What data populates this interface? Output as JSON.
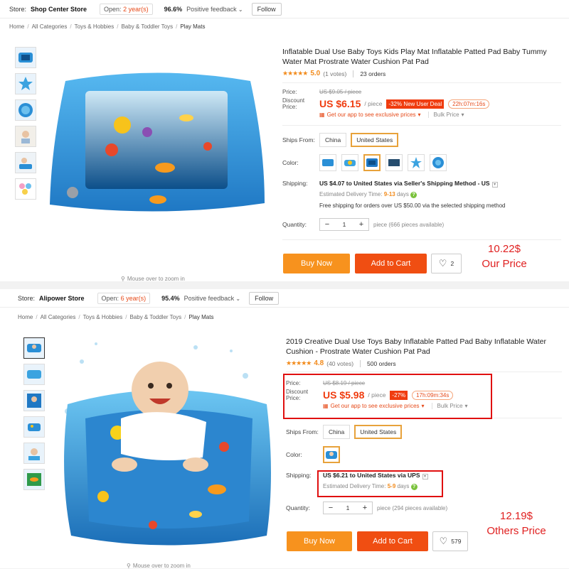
{
  "listings": [
    {
      "store": {
        "label": "Store:",
        "name": "Shop Center Store",
        "open_prefix": "Open:",
        "open_years": "2 year(s)",
        "feedback_pct": "96.6%",
        "feedback_label": "Positive feedback",
        "follow": "Follow"
      },
      "breadcrumb": {
        "items": [
          "Home",
          "All Categories",
          "Toys & Hobbies",
          "Baby & Toddler Toys",
          "Play Mats"
        ],
        "sep": "/"
      },
      "title": "Inflatable Dual Use Baby Toys Kids Play Mat Inflatable Patted Pad Baby Tummy Water Mat Prostrate Water Cushion Pat Pad",
      "rating": "5.0",
      "votes": "(1 votes)",
      "orders": "23 orders",
      "price_label": "Price:",
      "old_price": "US $9.05 / piece",
      "discount_label": "Discount Price:",
      "new_price": "US $6.15",
      "per_piece": "/ piece",
      "discount_badge": "-32% New User Deal",
      "timer": "22h:07m:16s",
      "app_promo": "Get our app to see exclusive prices",
      "bulk_price": "Bulk Price",
      "ships_from_label": "Ships From:",
      "ships_from": [
        "China",
        "United States"
      ],
      "color_label": "Color:",
      "shipping_label": "Shipping:",
      "shipping_main": "US $4.07 to United States via Seller's Shipping Method - US",
      "delivery_prefix": "Estimated Delivery Time:",
      "delivery_days": "9-13",
      "delivery_suffix": "days",
      "free_shipping": "Free shipping for orders over US $50.00 via the selected shipping method",
      "quantity_label": "Quantity:",
      "quantity": "1",
      "available": "piece (666 pieces available)",
      "buy_now": "Buy Now",
      "add_to_cart": "Add to Cart",
      "wish_count": "2",
      "zoom_hint": "Mouse over to zoom in",
      "annotation_value": "10.22$",
      "annotation_label": "Our Price"
    },
    {
      "store": {
        "label": "Store:",
        "name": "Alipower Store",
        "open_prefix": "Open:",
        "open_years": "6 year(s)",
        "feedback_pct": "95.4%",
        "feedback_label": "Positive feedback",
        "follow": "Follow"
      },
      "breadcrumb": {
        "items": [
          "Home",
          "All Categories",
          "Toys & Hobbies",
          "Baby & Toddler Toys",
          "Play Mats"
        ],
        "sep": "/"
      },
      "title": "2019 Creative Dual Use Toys Baby Inflatable Patted Pad Baby Inflatable Water Cushion - Prostrate Water Cushion Pat Pad",
      "rating": "4.8",
      "votes": "(40 votes)",
      "orders": "500 orders",
      "price_label": "Price:",
      "old_price": "US $8.19 / piece",
      "discount_label": "Discount Price:",
      "new_price": "US $5.98",
      "per_piece": "/ piece",
      "discount_badge": "-27%",
      "timer": "17h:09m:34s",
      "app_promo": "Get our app to see exclusive prices",
      "bulk_price": "Bulk Price",
      "ships_from_label": "Ships From:",
      "ships_from": [
        "China",
        "United States"
      ],
      "color_label": "Color:",
      "shipping_label": "Shipping:",
      "shipping_main": "US $6.21 to United States via UPS",
      "delivery_prefix": "Estimated Delivery Time:",
      "delivery_days": "5-9",
      "delivery_suffix": "days",
      "quantity_label": "Quantity:",
      "quantity": "1",
      "available": "piece (294 pieces available)",
      "buy_now": "Buy Now",
      "add_to_cart": "Add to Cart",
      "wish_count": "579",
      "zoom_hint": "Mouse over to zoom in",
      "annotation_value": "12.19$",
      "annotation_label": "Others Price"
    }
  ],
  "colors": {
    "accent": "#f03c0f",
    "buy": "#f7921e",
    "cart": "#f04e12",
    "star": "#f28b1c",
    "selected_border": "#e8a23b",
    "annotation": "#e02020"
  }
}
